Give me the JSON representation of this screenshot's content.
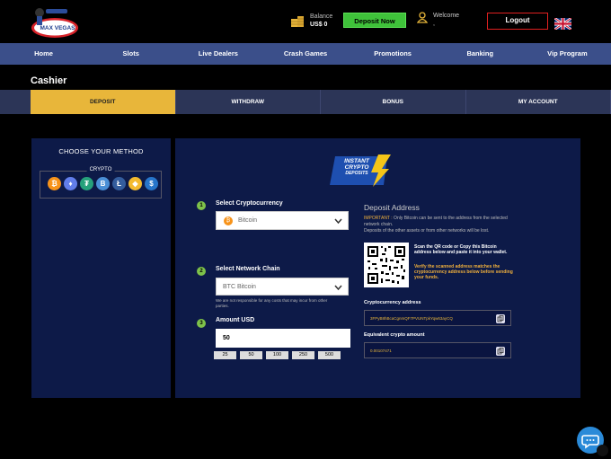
{
  "header": {
    "logo_text": "MAX VEGAS",
    "balance_label": "Balance",
    "balance_value": "US$ 0",
    "deposit_now": "Deposit Now",
    "welcome_label": "Welcome",
    "welcome_user": ",",
    "logout": "Logout"
  },
  "nav": [
    "Home",
    "Slots",
    "Live Dealers",
    "Crash Games",
    "Promotions",
    "Banking",
    "Vip Program"
  ],
  "page_title": "Cashier",
  "tabs": [
    "DEPOSIT",
    "WITHDRAW",
    "BONUS",
    "MY ACCOUNT"
  ],
  "sidebar": {
    "title": "CHOOSE YOUR METHOD",
    "group_label": "CRYPTO",
    "coins": [
      {
        "icon": "bitcoin-icon",
        "glyph": "₿",
        "color": "#f7931a"
      },
      {
        "icon": "ethereum-icon",
        "glyph": "♦",
        "color": "#627eea"
      },
      {
        "icon": "tether-icon",
        "glyph": "₮",
        "color": "#26a17b"
      },
      {
        "icon": "bitcoin-cash-icon",
        "glyph": "B",
        "color": "#4a8fd6"
      },
      {
        "icon": "litecoin-icon",
        "glyph": "Ł",
        "color": "#345d9d"
      },
      {
        "icon": "bnb-icon",
        "glyph": "◆",
        "color": "#f3ba2f"
      },
      {
        "icon": "usdc-icon",
        "glyph": "$",
        "color": "#2775ca"
      }
    ]
  },
  "badge": {
    "line1": "INSTANT",
    "line2": "CRYPTO",
    "line3": "DEPOSITS"
  },
  "form": {
    "step1": "1",
    "step2": "2",
    "step3": "3",
    "select_crypto_label": "Select Cryptocurrency",
    "crypto_value": "Bitcoin",
    "select_chain_label": "Select Network Chain",
    "chain_value": "BTC Bitcoin",
    "chain_note": "We are not responsible for any costs that may incur from other parties.",
    "amount_label": "Amount USD",
    "amount_value": "50",
    "quick_amounts": [
      "25",
      "50",
      "100",
      "250",
      "500"
    ]
  },
  "deposit_address": {
    "title": "Deposit Address",
    "important_label": "IMPORTANT :",
    "important_text": " Only Bitcoin can be sent to the address from the selected network chain.",
    "important_text2": "Deposits of the other assets or from other networks will be lost.",
    "scan_text": "Scan the QR code or Copy this Bitcoin address below and paste it into your wallet.",
    "verify_text": "Verify the scanned address matches the cryptocurrency address below before sending your funds.",
    "crypto_address_label": "Cryptocurrency address",
    "crypto_address_value": "3FPyB8hBcaCgnmQF7PVUNTpkYqw63ayCQ",
    "equivalent_label": "Equivalent crypto amount",
    "equivalent_value": "0.00107471"
  }
}
